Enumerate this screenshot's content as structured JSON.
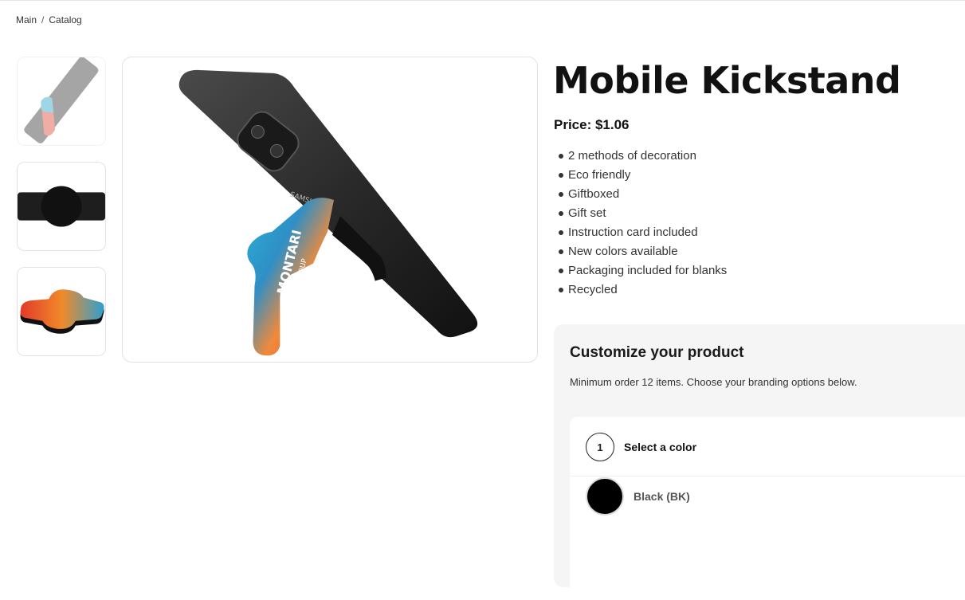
{
  "breadcrumb": {
    "items": [
      "Main",
      "Catalog"
    ],
    "separator": "/"
  },
  "gallery": {
    "thumbnails": [
      {
        "label": "phone-with-kickstand",
        "active": true
      },
      {
        "label": "kickstand-black-strip",
        "active": false
      },
      {
        "label": "kickstand-printed-flat",
        "active": false
      }
    ],
    "main_image_logo_text": "MONTARI",
    "main_image_logo_sub": "GROUP",
    "phone_brand_text": "SAMSUNG"
  },
  "product": {
    "title": "Mobile Kickstand",
    "price": "Price: $1.06",
    "features": [
      "2 methods of decoration",
      "Eco friendly",
      "Giftboxed",
      "Gift set",
      "Instruction card included",
      "New colors available",
      "Packaging included for blanks",
      "Recycled"
    ]
  },
  "customize": {
    "title": "Customize your product",
    "subtitle": "Minimum order 12 items. Choose your branding options below.",
    "step": {
      "number": "1",
      "label": "Select a color"
    },
    "colors": [
      {
        "name": "Black (BK)",
        "hex": "#000000"
      }
    ]
  }
}
